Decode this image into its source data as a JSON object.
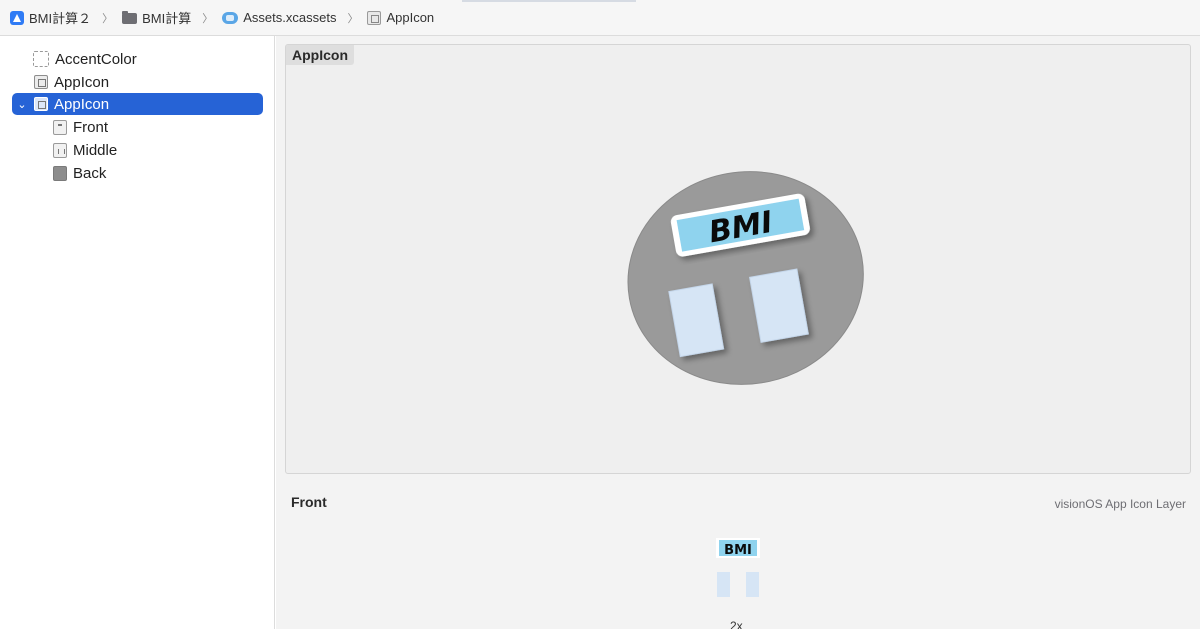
{
  "breadcrumb": [
    {
      "label": "BMI計算２",
      "icon": "app-icon"
    },
    {
      "label": "BMI計算",
      "icon": "folder-icon"
    },
    {
      "label": "Assets.xcassets",
      "icon": "asset-catalog-icon"
    },
    {
      "label": "AppIcon",
      "icon": "image-set-icon"
    }
  ],
  "breadcrumb_separator": "〉",
  "sidebar": {
    "items": [
      {
        "label": "AccentColor",
        "icon": "color-set-icon",
        "level": 0,
        "selected": false
      },
      {
        "label": "AppIcon",
        "icon": "image-set-icon",
        "level": 0,
        "selected": false
      },
      {
        "label": "AppIcon",
        "icon": "image-set-icon",
        "level": 0,
        "selected": true,
        "expanded": true
      },
      {
        "label": "Front",
        "icon": "layer-front-icon",
        "level": 1,
        "selected": false
      },
      {
        "label": "Middle",
        "icon": "layer-middle-icon",
        "level": 1,
        "selected": false
      },
      {
        "label": "Back",
        "icon": "layer-back-icon",
        "level": 1,
        "selected": false
      }
    ]
  },
  "preview": {
    "label": "AppIcon",
    "icon_text": "BMI"
  },
  "detail": {
    "title": "Front",
    "subtitle": "visionOS App Icon Layer",
    "thumb_text": "BMI",
    "scale": "2x"
  },
  "colors": {
    "selection": "#2663d6",
    "badge_fill": "#8fd3ee",
    "panel_fill": "#d6e5f5",
    "disc": "#9a9a9a"
  }
}
